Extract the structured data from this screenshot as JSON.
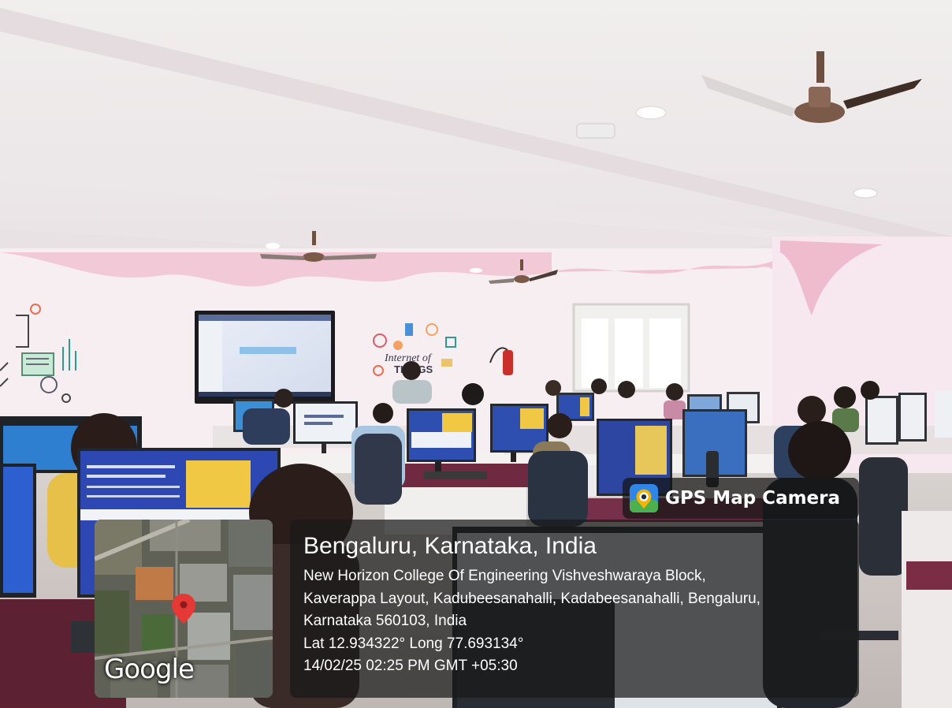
{
  "overlay": {
    "app_title": "GPS Map Camera",
    "map_provider": "Google",
    "location_title": "Bengaluru, Karnataka, India",
    "address_lines": [
      "New Horizon College Of Engineering Vishveshwaraya Block,",
      "Kaverappa Layout, Kadubeesanahalli, Kadabeesanahalli, Bengaluru,",
      "Karnataka 560103, India"
    ],
    "coordinates": "Lat 12.934322° Long 77.693134°",
    "datetime": "14/02/25 02:25 PM GMT +05:30"
  },
  "scene": {
    "wall_art": {
      "line1": "Internet of",
      "line2": "THINGS"
    }
  },
  "colors": {
    "wall_pink": "#f2c9d6",
    "ceiling": "#f3f1f1",
    "desk_maroon": "#7a2d45",
    "monitor_blue": "#2f4fb0",
    "monitor_yellow": "#f0c844",
    "map_pin_red": "#e53935"
  },
  "icons": [
    "gps-map-camera-app-icon",
    "map-pin-icon",
    "ceiling-fan-icon"
  ]
}
